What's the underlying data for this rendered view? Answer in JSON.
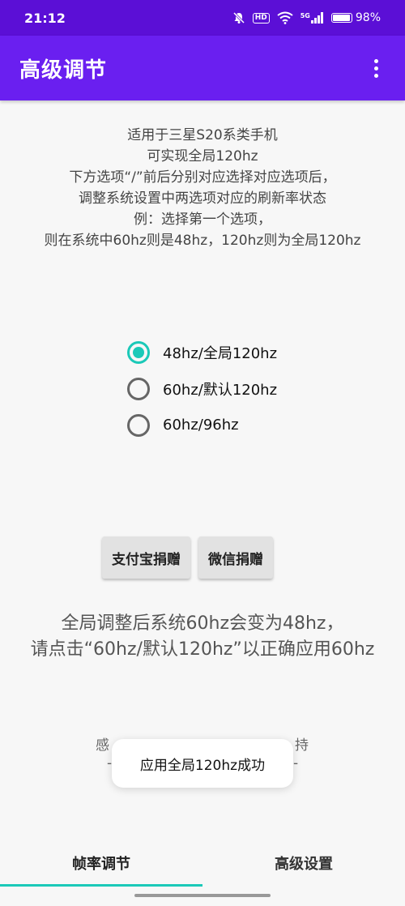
{
  "status_bar": {
    "time": "21:12",
    "hd_label": "HD",
    "network_label": "5G",
    "battery_percent": "98%",
    "battery_level": 0.98
  },
  "app_bar": {
    "title": "高级调节"
  },
  "description": {
    "lines": [
      "适用于三星S20系类手机",
      "可实现全局120hz",
      "下方选项“/”前后分别对应选择对应选项后，",
      "调整系统设置中两选项对应的刷新率状态",
      "例：选择第一个选项，",
      "则在系统中60hz则是48hz，120hz则为全局120hz"
    ]
  },
  "refresh_options": {
    "selected_index": 0,
    "items": [
      {
        "label": "48hz/全局120hz"
      },
      {
        "label": "60hz/默认120hz"
      },
      {
        "label": "60hz/96hz"
      }
    ]
  },
  "donate": {
    "alipay_label": "支付宝捐赠",
    "wechat_label": "微信捐赠"
  },
  "notice": {
    "lines": [
      "全局调整后系统60hz会变为48hz，",
      "请点击“60hz/默认120hz”以正确应用60hz"
    ]
  },
  "partial_text": {
    "left": "感",
    "right": "持",
    "dash_left": "-",
    "dash_right": "-"
  },
  "toast": {
    "message": "应用全局120hz成功"
  },
  "bottom_nav": {
    "tabs": [
      {
        "label": "帧率调节",
        "active": true
      },
      {
        "label": "高级设置",
        "active": false
      }
    ]
  },
  "colors": {
    "status_bar": "#5b0fd6",
    "app_bar": "#6a1ff0",
    "accent": "#1bc9b8"
  }
}
